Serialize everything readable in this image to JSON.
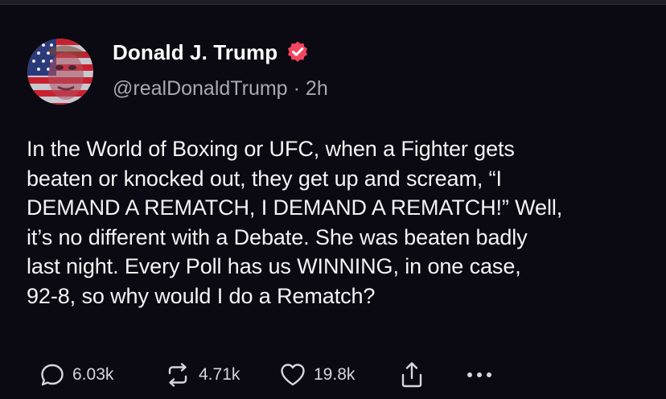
{
  "author": {
    "name": "Donald J. Trump",
    "handle": "@realDonaldTrump",
    "time_separator": "·",
    "time": "2h",
    "verified_color": "#f2455f"
  },
  "post": {
    "text": "In the World of Boxing or UFC, when a Fighter gets\nbeaten or knocked out, they get up and scream, “I\nDEMAND A REMATCH, I DEMAND A REMATCH!” Well,\nit’s no different with a Debate. She was beaten badly\nlast night. Every Poll has us WINNING, in one case,\n92-8, so why would I do a Rematch?"
  },
  "actions": {
    "replies": "6.03k",
    "reposts": "4.71k",
    "likes": "19.8k"
  },
  "icons": {
    "reply": "speech-bubble-icon",
    "repost": "repost-arrows-icon",
    "like": "heart-icon",
    "share": "share-upload-icon",
    "more": "more-dots-icon",
    "verified": "verified-badge-icon"
  },
  "colors": {
    "background": "#0b0a12",
    "text": "#f4f4f6",
    "secondary_text": "#a9a9b2"
  }
}
